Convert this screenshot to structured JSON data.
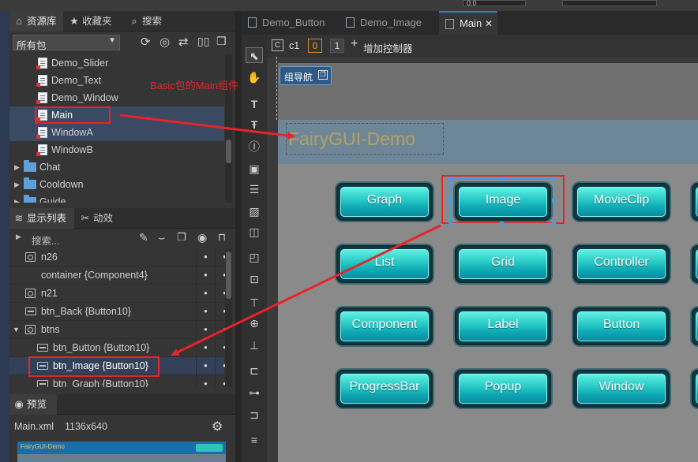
{
  "top_strip": {
    "field_value": "0.0"
  },
  "asset_panel": {
    "tabs": [
      {
        "label": "资源库",
        "icon": "library-icon"
      },
      {
        "label": "收藏夹",
        "icon": "star-icon"
      },
      {
        "label": "搜索",
        "icon": "search-icon"
      }
    ],
    "package_select": "所有包",
    "tree": [
      {
        "label": "Demo_Slider",
        "type": "component"
      },
      {
        "label": "Demo_Text",
        "type": "component"
      },
      {
        "label": "Demo_Window",
        "type": "component"
      },
      {
        "label": "Main",
        "type": "component",
        "selected": true
      },
      {
        "label": "WindowA",
        "type": "component"
      },
      {
        "label": "WindowB",
        "type": "component"
      },
      {
        "label": "Chat",
        "type": "folder"
      },
      {
        "label": "Cooldown",
        "type": "folder"
      },
      {
        "label": "Guide",
        "type": "folder"
      }
    ]
  },
  "annotation": {
    "text": "Basic包的Main组件",
    "color": "#e8232a"
  },
  "display_panel": {
    "tabs": [
      {
        "label": "显示列表"
      },
      {
        "label": "动效"
      }
    ],
    "search_placeholder": "搜索...",
    "rows": [
      {
        "label": "n26",
        "icon": "image",
        "indent": 0
      },
      {
        "label": "container {Component4}",
        "icon": "none",
        "indent": 0
      },
      {
        "label": "n21",
        "icon": "image",
        "indent": 0
      },
      {
        "label": "btn_Back {Button10}",
        "icon": "button",
        "indent": 0
      },
      {
        "label": "btns",
        "icon": "group",
        "indent": 0,
        "expanded": true
      },
      {
        "label": "btn_Button {Button10}",
        "icon": "button",
        "indent": 1
      },
      {
        "label": "btn_Image {Button10}",
        "icon": "button",
        "indent": 1,
        "selected": true
      },
      {
        "label": "btn_Graph {Button10}",
        "icon": "button",
        "indent": 1
      }
    ],
    "dot": "•"
  },
  "preview_panel": {
    "title": "预览",
    "file": "Main.xml",
    "size": "1136x640",
    "thumb_title": "FairyGUI-Demo"
  },
  "doc_tabs": [
    {
      "label": "Demo_Button"
    },
    {
      "label": "Demo_Image"
    },
    {
      "label": "Main",
      "active": true,
      "close": "✕"
    }
  ],
  "controller_bar": {
    "controller": "c1",
    "pages": [
      "0",
      "1"
    ],
    "add_label": "增加控制器"
  },
  "stage": {
    "nav_label": "组导航",
    "title_text": "FairyGUI-Demo",
    "buttons": [
      [
        "Graph",
        "Image",
        "MovieClip"
      ],
      [
        "List",
        "Grid",
        "Controller"
      ],
      [
        "Component",
        "Label",
        "Button"
      ],
      [
        "ProgressBar",
        "Popup",
        "Window"
      ]
    ]
  },
  "colors": {
    "accent": "#3a78c8",
    "selection": "#334158",
    "highlight_red": "#e8232a",
    "button_teal": "#25c7c2"
  }
}
